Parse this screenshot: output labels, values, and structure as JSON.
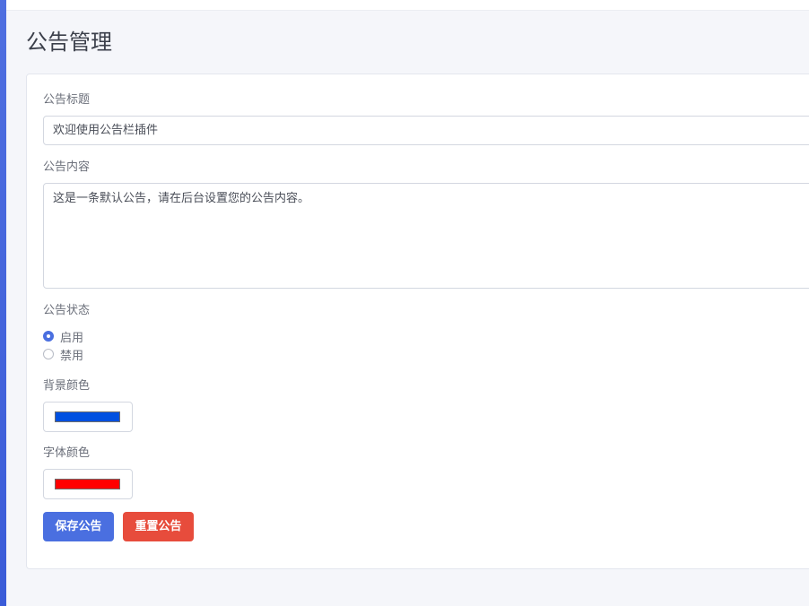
{
  "page": {
    "title": "公告管理"
  },
  "form": {
    "title_label": "公告标题",
    "title_value": "欢迎使用公告栏插件",
    "content_label": "公告内容",
    "content_value": "这是一条默认公告，请在后台设置您的公告内容。",
    "status_label": "公告状态",
    "status_options": [
      {
        "label": "启用",
        "checked": true
      },
      {
        "label": "禁用",
        "checked": false
      }
    ],
    "bg_color_label": "背景颜色",
    "bg_color_value": "#0050e0",
    "font_color_label": "字体颜色",
    "font_color_value": "#ff0000"
  },
  "actions": {
    "save_label": "保存公告",
    "reset_label": "重置公告"
  },
  "colors": {
    "primary": "#4a6fe0",
    "danger": "#e74c3c"
  }
}
